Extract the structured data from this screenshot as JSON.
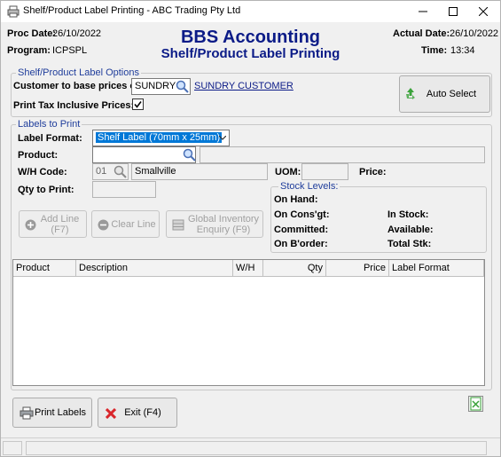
{
  "window": {
    "title": "Shelf/Product Label Printing - ABC Trading Pty Ltd"
  },
  "header": {
    "proc_date_label": "Proc Date:",
    "proc_date": "26/10/2022",
    "program_label": "Program:",
    "program": "ICPSPL",
    "app_name": "BBS Accounting",
    "screen_title": "Shelf/Product Label Printing",
    "actual_date_label": "Actual Date:",
    "actual_date": "26/10/2022",
    "time_label": "Time:",
    "time": "13:34"
  },
  "options": {
    "legend": "Shelf/Product Label Options",
    "customer_label": "Customer to base prices on:",
    "customer_code": "SUNDRY",
    "customer_name": "SUNDRY CUSTOMER",
    "tax_label": "Print Tax Inclusive Prices:",
    "tax_checked": true,
    "auto_select": "Auto Select"
  },
  "labels": {
    "legend": "Labels to Print",
    "label_format_label": "Label Format:",
    "label_format_value": "Shelf Label (70mm x 25mm)",
    "product_label": "Product:",
    "product_value": "",
    "product_desc": "",
    "wh_label": "W/H Code:",
    "wh_code": "01",
    "wh_name": "Smallville",
    "uom_label": "UOM:",
    "uom_value": "",
    "price_label": "Price:",
    "qty_label": "Qty to Print:",
    "qty_value": ""
  },
  "stock": {
    "legend": "Stock Levels:",
    "on_hand": "On Hand:",
    "on_consgt": "On Cons'gt:",
    "in_stock": "In Stock:",
    "committed": "Committed:",
    "available": "Available:",
    "on_border": "On B'order:",
    "total_stk": "Total Stk:"
  },
  "actions": {
    "add_line_1": "Add Line",
    "add_line_2": "(F7)",
    "clear_line": "Clear Line",
    "global_1": "Global Inventory",
    "global_2": "Enquiry (F9)"
  },
  "grid": {
    "columns": [
      "Product",
      "Description",
      "W/H",
      "Qty",
      "Price",
      "Label Format"
    ]
  },
  "footer": {
    "print_labels": "Print Labels",
    "exit": "Exit (F4)"
  },
  "colors": {
    "title_blue": "#0b1b87",
    "selection_blue": "#0078d7",
    "exit_red": "#d9262b",
    "icon_green": "#3aa23a"
  }
}
